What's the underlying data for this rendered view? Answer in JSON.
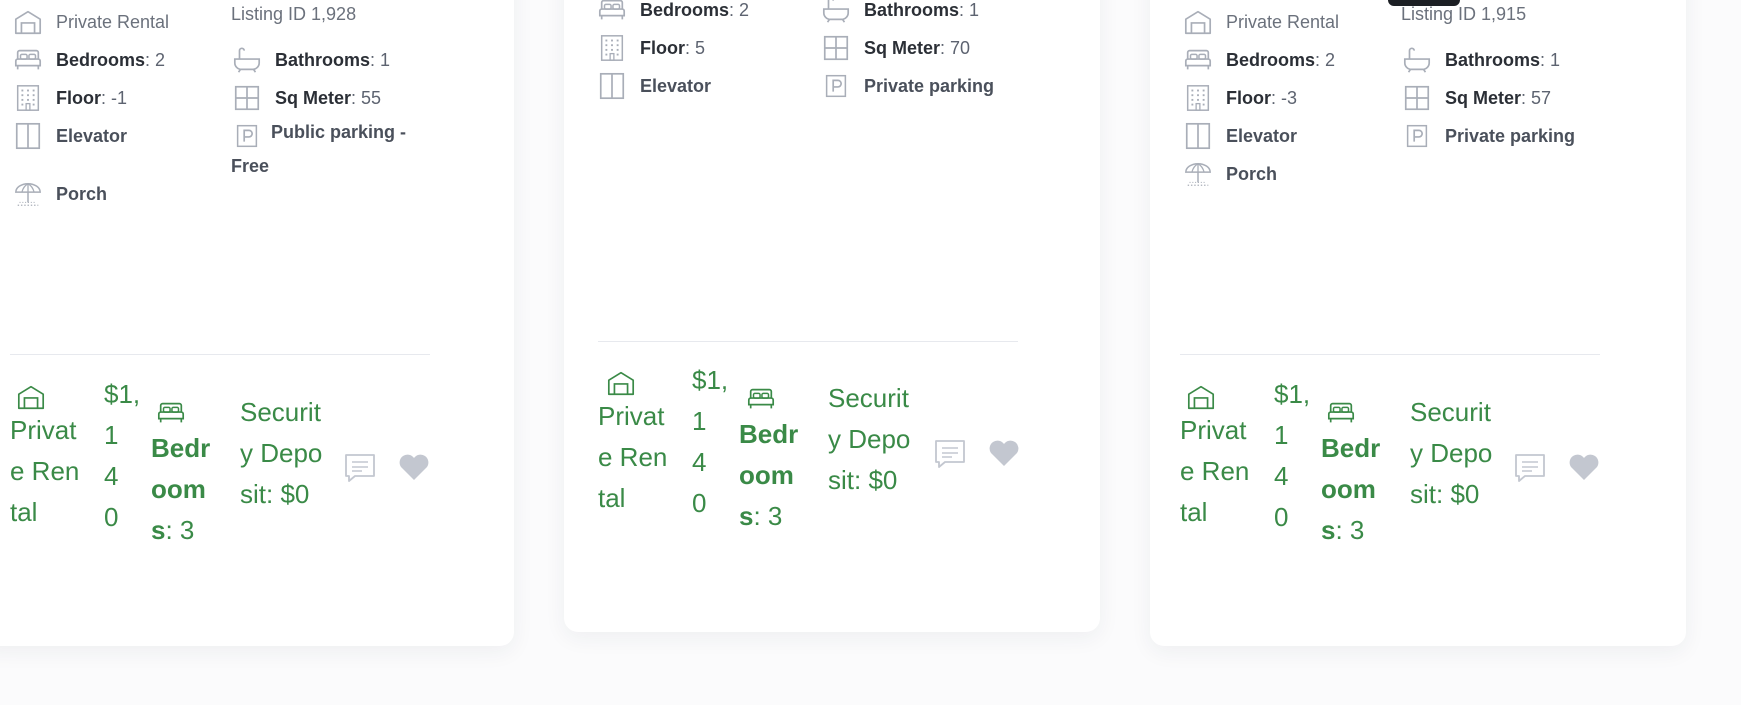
{
  "colors": {
    "accent_green": "#3a8a47",
    "icon_gray": "#a9aeb8",
    "heart_gray": "#c3c7d0"
  },
  "cards": [
    {
      "features": {
        "type": "Private Rental",
        "listing_id": "Listing ID 1,928",
        "bedrooms_label": "Bedrooms",
        "bedrooms_value": ": 2",
        "bathrooms_label": "Bathrooms",
        "bathrooms_value": ": 1",
        "floor_label": "Floor",
        "floor_value": ": -1",
        "sqm_label": "Sq Meter",
        "sqm_value": ": 55",
        "elevator": "Elevator",
        "parking": "Public parking - Free",
        "porch": "Porch"
      },
      "footer": {
        "type": "Private Rental",
        "price": "$1,140",
        "bedrooms_label": "Bedrooms",
        "bedrooms_value": ": 3",
        "deposit": "Security Deposit: $0"
      }
    },
    {
      "features": {
        "bedrooms_label": "Bedrooms",
        "bedrooms_value": ": 2",
        "bathrooms_label": "Bathrooms",
        "bathrooms_value": ": 1",
        "floor_label": "Floor",
        "floor_value": ": 5",
        "sqm_label": "Sq Meter",
        "sqm_value": ": 70",
        "elevator": "Elevator",
        "parking": "Private parking"
      },
      "footer": {
        "type": "Private Rental",
        "price": "$1,140",
        "bedrooms_label": "Bedrooms",
        "bedrooms_value": ": 3",
        "deposit": "Security Deposit: $0"
      }
    },
    {
      "features": {
        "type": "Private Rental",
        "listing_id": "Listing ID 1,915",
        "bedrooms_label": "Bedrooms",
        "bedrooms_value": ": 2",
        "bathrooms_label": "Bathrooms",
        "bathrooms_value": ": 1",
        "floor_label": "Floor",
        "floor_value": ": -3",
        "sqm_label": "Sq Meter",
        "sqm_value": ": 57",
        "elevator": "Elevator",
        "parking": "Private parking",
        "porch": "Porch"
      },
      "footer": {
        "type": "Private Rental",
        "price": "$1,140",
        "bedrooms_label": "Bedrooms",
        "bedrooms_value": ": 3",
        "deposit": "Security Deposit: $0"
      }
    }
  ],
  "icons": [
    "house-icon",
    "bed-icon",
    "bathtub-icon",
    "building-icon",
    "grid-icon",
    "elevator-icon",
    "parking-icon",
    "umbrella-icon",
    "comment-icon",
    "heart-icon"
  ]
}
